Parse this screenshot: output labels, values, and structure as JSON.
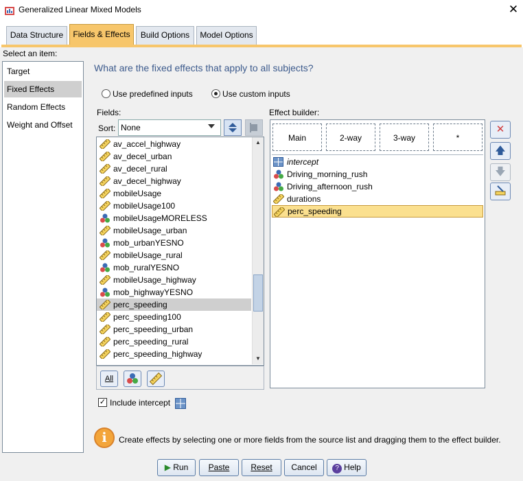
{
  "window": {
    "title": "Generalized Linear Mixed Models",
    "close_glyph": "✕"
  },
  "tabs": [
    {
      "label": "Data Structure",
      "active": false
    },
    {
      "label": "Fields & Effects",
      "active": true
    },
    {
      "label": "Build Options",
      "active": false
    },
    {
      "label": "Model Options",
      "active": false
    }
  ],
  "nav": {
    "label": "Select an item:",
    "items": [
      "Target",
      "Fixed Effects",
      "Random Effects",
      "Weight and Offset"
    ],
    "selected": "Fixed Effects"
  },
  "question": "What are the fixed effects that apply to all subjects?",
  "inputs_mode": {
    "options": [
      "Use predefined inputs",
      "Use custom inputs"
    ],
    "selected": "Use custom inputs"
  },
  "fields": {
    "label": "Fields:",
    "sort_label": "Sort:",
    "sort_value": "None",
    "items": [
      {
        "name": "av_accel_highway",
        "type": "scale"
      },
      {
        "name": "av_decel_urban",
        "type": "scale"
      },
      {
        "name": "av_decel_rural",
        "type": "scale"
      },
      {
        "name": "av_decel_highway",
        "type": "scale"
      },
      {
        "name": "mobileUsage",
        "type": "scale"
      },
      {
        "name": "mobileUsage100",
        "type": "scale"
      },
      {
        "name": "mobileUsageMORELESS",
        "type": "nominal"
      },
      {
        "name": "mobileUsage_urban",
        "type": "scale"
      },
      {
        "name": "mob_urbanYESNO",
        "type": "nominal"
      },
      {
        "name": "mobileUsage_rural",
        "type": "scale"
      },
      {
        "name": "mob_ruralYESNO",
        "type": "nominal"
      },
      {
        "name": "mobileUsage_highway",
        "type": "scale"
      },
      {
        "name": "mob_highwayYESNO",
        "type": "nominal"
      },
      {
        "name": "perc_speeding",
        "type": "scale"
      },
      {
        "name": "perc_speeding100",
        "type": "scale"
      },
      {
        "name": "perc_speeding_urban",
        "type": "scale"
      },
      {
        "name": "perc_speeding_rural",
        "type": "scale"
      },
      {
        "name": "perc_speeding_highway",
        "type": "scale"
      }
    ],
    "selected": "perc_speeding",
    "tool_all_label": "All"
  },
  "builder": {
    "label": "Effect builder:",
    "drop_zones": [
      "Main",
      "2-way",
      "3-way",
      "*"
    ],
    "effects": [
      {
        "name": "intercept",
        "type": "intercept"
      },
      {
        "name": "Driving_morning_rush",
        "type": "nominal"
      },
      {
        "name": "Driving_afternoon_rush",
        "type": "nominal"
      },
      {
        "name": "durations",
        "type": "scale"
      },
      {
        "name": "perc_speeding",
        "type": "scale"
      }
    ],
    "selected": "perc_speeding"
  },
  "include_intercept": {
    "label": "Include intercept",
    "checked": true
  },
  "info_text": "Create effects by selecting one or more fields from the source list and dragging them to the effect builder.",
  "buttons": {
    "run": "Run",
    "paste": "Paste",
    "reset": "Reset",
    "cancel": "Cancel",
    "help": "Help"
  },
  "colors": {
    "active_tab": "#f7c66b",
    "selection": "#fbe08f",
    "question": "#3c5a8c"
  }
}
